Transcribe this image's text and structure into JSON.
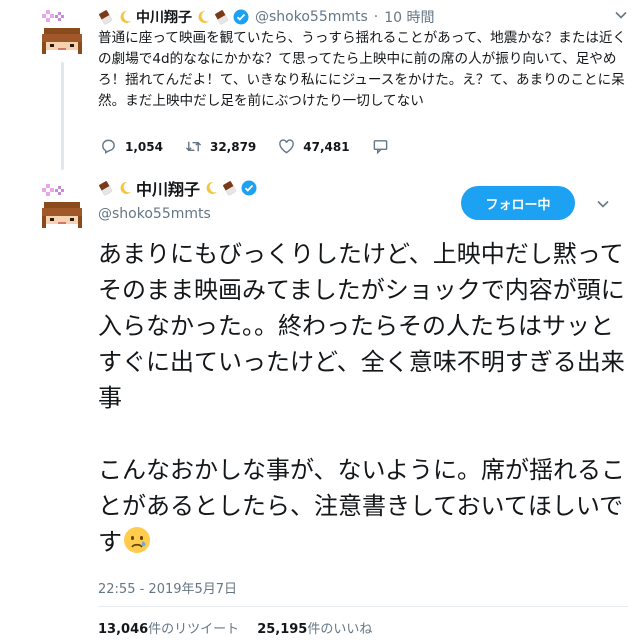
{
  "colors": {
    "accent": "#1da1f2",
    "text": "#14171a",
    "muted": "#657786",
    "divider": "#e6ecf0",
    "verified": "#1da1f2"
  },
  "tweet1": {
    "display_name": "中川翔子",
    "handle": "@shoko55mmts",
    "time": "10 時間",
    "text": "普通に座って映画を観ていたら、うっすら揺れることがあって、地震かな？または近くの劇場で4d的ななにかかな？て思ってたら上映中に前の席の人が振り向いて、足やめろ！揺れてんだよ！て、いきなり私ににジュースをかけた。え？て、あまりのことに呆然。まだ上映中だし足を前にぶつけたり一切してない",
    "icons": {
      "reply": "reply-icon",
      "retweet": "retweet-icon",
      "like": "heart-icon",
      "message": "message-icon"
    },
    "replies": "1,054",
    "retweets": "32,879",
    "likes": "47,481"
  },
  "tweet2": {
    "display_name": "中川翔子",
    "handle": "@shoko55mmts",
    "follow_label": "フォロー中",
    "paragraph1": "あまりにもびっくりしたけど、上映中だし黙ってそのまま映画みてましたがショックで内容が頭に入らなかった。。終わったらその人たちはサッとすぐに出ていったけど、全く意味不明すぎる出来事",
    "paragraph2": "こんなおかしな事が、ないように。席が揺れることがあるとしたら、注意書きしておいてほしいです",
    "timestamp": "22:55 - 2019年5月7日",
    "retweet_count": "13,046",
    "retweet_label": "件のリツイート",
    "like_count": "25,195",
    "like_label": "件のいいね"
  }
}
